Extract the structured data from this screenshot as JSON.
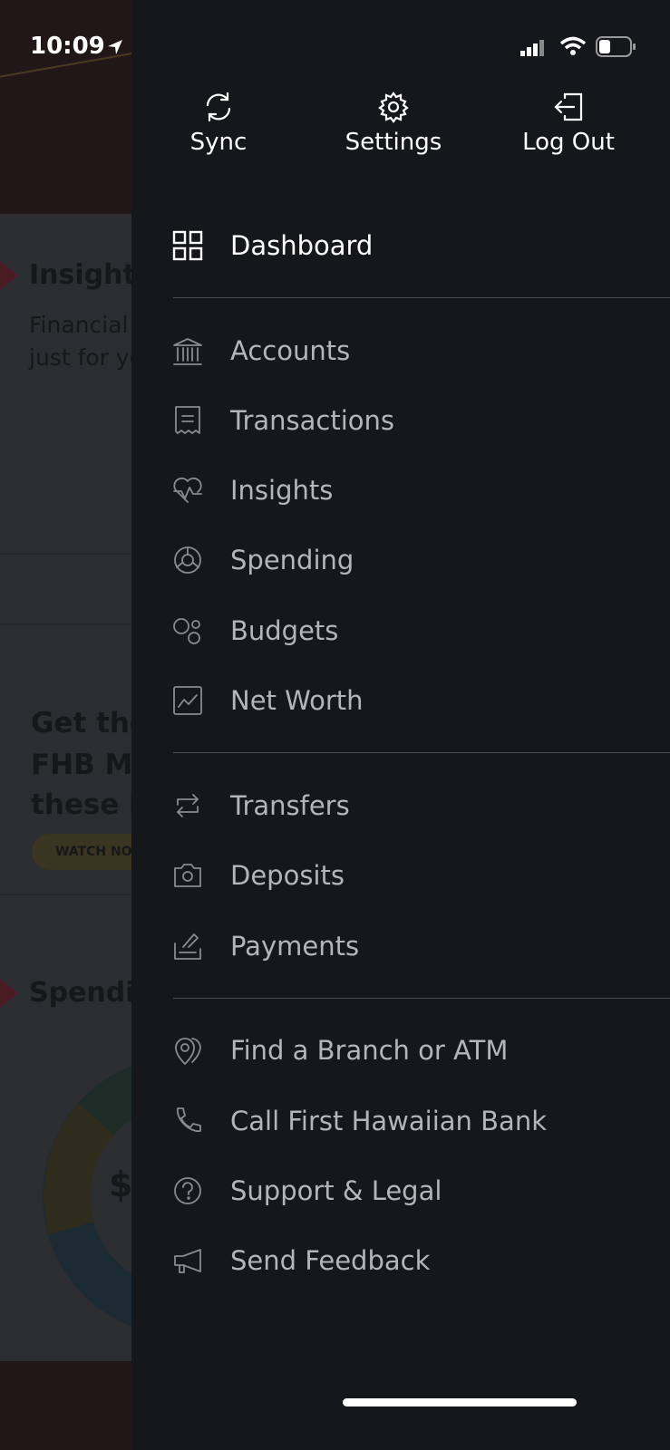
{
  "status_bar": {
    "time": "10:09"
  },
  "background": {
    "insights_title": "Insights",
    "insights_sub1": "Financial",
    "insights_sub2": "just for yo",
    "promo1": "Get the",
    "promo2": "FHB Mo",
    "promo3": "these h",
    "promo_button": "WATCH NO",
    "spending_title": "Spendin",
    "spending_amount": "$"
  },
  "top_actions": [
    {
      "label": "Sync",
      "icon": "sync-icon"
    },
    {
      "label": "Settings",
      "icon": "gear-icon"
    },
    {
      "label": "Log Out",
      "icon": "logout-icon"
    }
  ],
  "menu": [
    {
      "label": "Dashboard",
      "icon": "grid-icon",
      "active": true
    },
    {
      "label": "Accounts",
      "icon": "bank-icon"
    },
    {
      "label": "Transactions",
      "icon": "receipt-icon"
    },
    {
      "label": "Insights",
      "icon": "heart-pulse-icon"
    },
    {
      "label": "Spending",
      "icon": "pie-chart-icon"
    },
    {
      "label": "Budgets",
      "icon": "bubbles-icon"
    },
    {
      "label": "Net Worth",
      "icon": "line-chart-icon"
    },
    {
      "label": "Transfers",
      "icon": "transfer-icon"
    },
    {
      "label": "Deposits",
      "icon": "camera-icon"
    },
    {
      "label": "Payments",
      "icon": "payment-icon"
    },
    {
      "label": "Find a Branch or ATM",
      "icon": "location-icon"
    },
    {
      "label": "Call First Hawaiian Bank",
      "icon": "phone-icon"
    },
    {
      "label": "Support & Legal",
      "icon": "help-icon"
    },
    {
      "label": "Send Feedback",
      "icon": "megaphone-icon"
    }
  ]
}
